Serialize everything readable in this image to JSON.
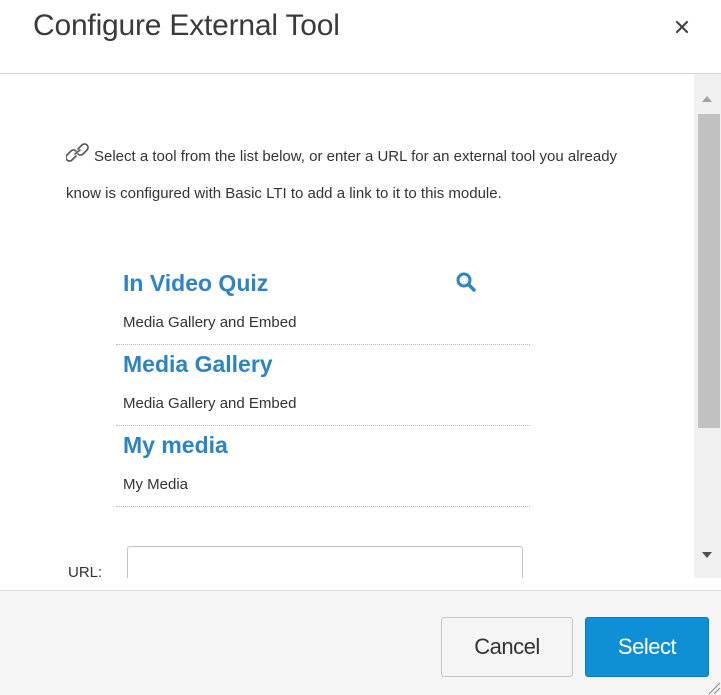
{
  "dialog": {
    "title": "Configure External Tool",
    "close_glyph": "×"
  },
  "intro": {
    "icon": "link-icon",
    "text": "Select a tool from the list below, or enter a URL for an external tool you already know is configured with Basic LTI to add a link to it to this module."
  },
  "tools": [
    {
      "name": "In Video Quiz",
      "description": "Media Gallery and Embed"
    },
    {
      "name": "Media Gallery",
      "description": "Media Gallery and Embed"
    },
    {
      "name": "My media",
      "description": "My Media"
    }
  ],
  "url": {
    "label": "URL:",
    "value": "",
    "placeholder": ""
  },
  "footer": {
    "cancel_label": "Cancel",
    "select_label": "Select"
  },
  "colors": {
    "accent": "#0f8fd6",
    "link": "#2d84c4",
    "footer_bg": "#f5f5f5"
  }
}
